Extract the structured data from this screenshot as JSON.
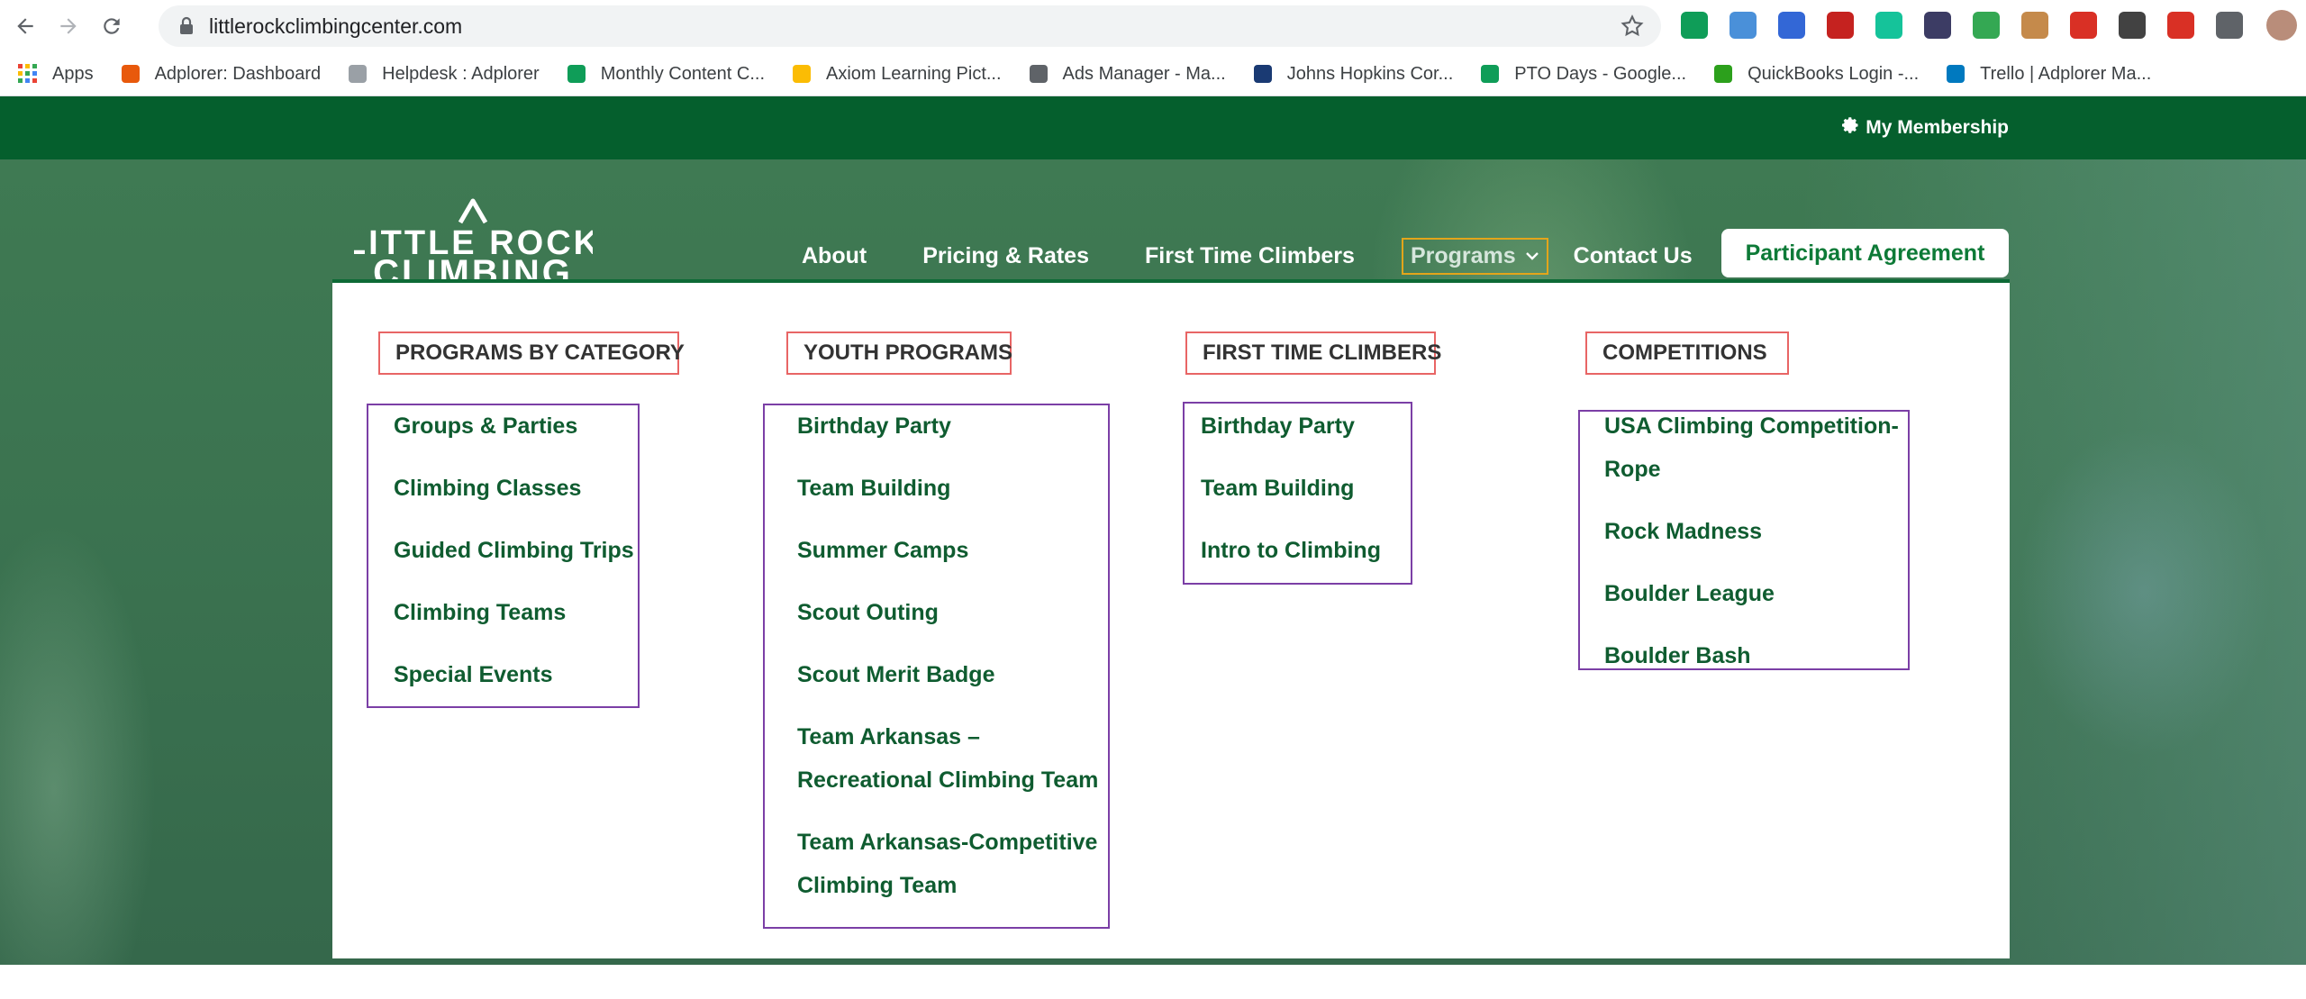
{
  "browser": {
    "url": "littlerockclimbingcenter.com",
    "bookmarks": [
      {
        "label": "Apps",
        "icon": "apps-grid-icon",
        "color": "#4285f4"
      },
      {
        "label": "Adplorer: Dashboard",
        "icon": "adplorer-icon",
        "color": "#e8590c"
      },
      {
        "label": "Helpdesk : Adplorer",
        "icon": "helpdesk-icon",
        "color": "#9aa0a6"
      },
      {
        "label": "Monthly Content C...",
        "icon": "google-sheets-icon",
        "color": "#0f9d58"
      },
      {
        "label": "Axiom Learning Pict...",
        "icon": "google-drive-icon",
        "color": "#fbbc04"
      },
      {
        "label": "Ads Manager - Ma...",
        "icon": "ads-manager-icon",
        "color": "#5f6368"
      },
      {
        "label": "Johns Hopkins Cor...",
        "icon": "johns-hopkins-icon",
        "color": "#1a3a73"
      },
      {
        "label": "PTO Days - Google...",
        "icon": "google-sheets-icon",
        "color": "#0f9d58"
      },
      {
        "label": "QuickBooks Login -...",
        "icon": "quickbooks-icon",
        "color": "#2ca01c"
      },
      {
        "label": "Trello | Adplorer Ma...",
        "icon": "trello-icon",
        "color": "#0079bf"
      }
    ],
    "extensions": [
      {
        "icon": "green-bubble-icon",
        "color": "#0f9d58"
      },
      {
        "icon": "calendar-ext-icon",
        "color": "#4a90d9"
      },
      {
        "icon": "search-ext-icon",
        "color": "#3367d6"
      },
      {
        "icon": "pdf-icon",
        "color": "#c5221f"
      },
      {
        "icon": "grammarly-icon",
        "color": "#15c39a"
      },
      {
        "icon": "k-ext-icon",
        "color": "#3c3c64"
      },
      {
        "icon": "inbox-ext-icon",
        "color": "#34a853"
      },
      {
        "icon": "box-ext-icon",
        "color": "#c58a4b"
      },
      {
        "icon": "clip-ext-icon",
        "color": "#d93025"
      },
      {
        "icon": "m-ext-icon",
        "color": "#424242"
      },
      {
        "icon": "dots-ext-icon",
        "color": "#d93025"
      },
      {
        "icon": "puzzle-icon",
        "color": "#5f6368"
      }
    ]
  },
  "site": {
    "membership_label": "My Membership",
    "logo_text_line1": "LITTLE ROCK",
    "logo_text_line2": "CLIMBING",
    "nav": {
      "about": "About",
      "pricing": "Pricing & Rates",
      "first_time": "First Time Climbers",
      "programs": "Programs",
      "contact": "Contact Us",
      "agreement": "Participant Agreement"
    },
    "colors": {
      "brand_green": "#055f2d",
      "link_green": "#0f5c30",
      "category_border": "#e86565",
      "group_border": "#7b3fa6",
      "highlight": "#e3a51b"
    },
    "menu": {
      "programs_by_category": {
        "title": "PROGRAMS BY CATEGORY",
        "items": [
          "Groups & Parties",
          "Climbing Classes",
          "Guided Climbing Trips",
          "Climbing Teams",
          "Special Events"
        ]
      },
      "youth_programs": {
        "title": "YOUTH PROGRAMS",
        "items": [
          "Birthday Party",
          "Team Building",
          "Summer Camps",
          "Scout Outing",
          "Scout Merit Badge",
          "Team Arkansas –",
          "Recreational Climbing Team",
          "Team Arkansas-Competitive",
          "Climbing Team"
        ]
      },
      "first_time_climbers": {
        "title": "FIRST TIME CLIMBERS",
        "items": [
          "Birthday Party",
          "Team Building",
          "Intro to Climbing"
        ]
      },
      "competitions": {
        "title": "COMPETITIONS",
        "items": [
          "USA Climbing Competition-",
          "Rope",
          "Rock Madness",
          "Boulder League",
          "Boulder Bash"
        ]
      }
    }
  }
}
